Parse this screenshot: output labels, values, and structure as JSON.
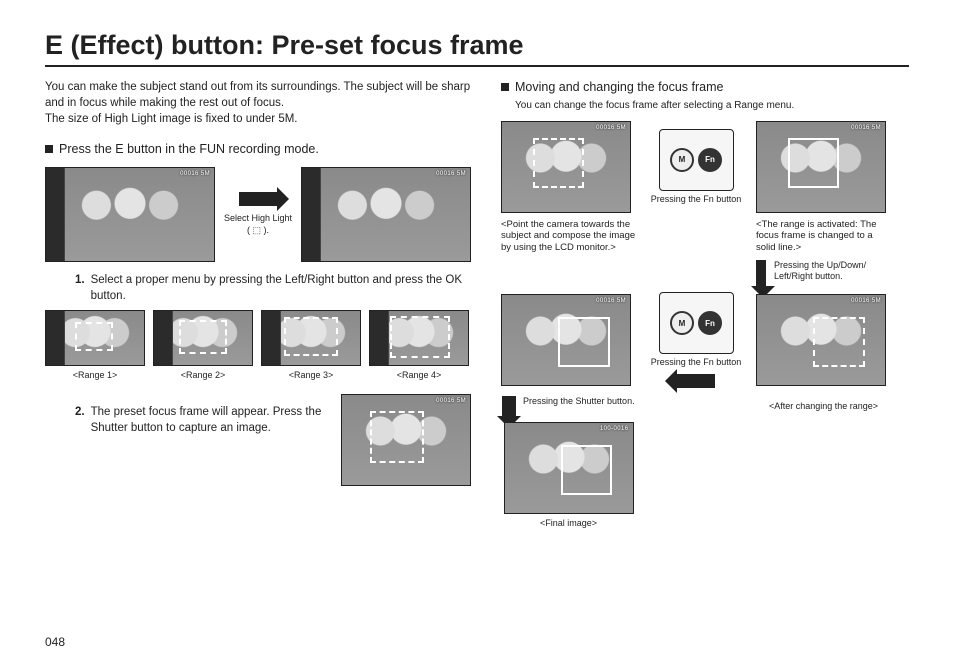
{
  "title": "E (Effect) button: Pre-set focus frame",
  "page_number": "048",
  "left": {
    "intro1": "You can make the subject stand out from its surroundings. The subject will be sharp and in focus while making the rest out of focus.",
    "intro2": "The size of High Light image is fixed to under 5M.",
    "bullet": "Press the E button in the FUN recording mode.",
    "select_highlight": "Select High Light",
    "select_icon_hint": "( ⬚ ).",
    "step1_num": "1.",
    "step1": "Select a proper menu by pressing the Left/Right button and press the OK button.",
    "ranges": [
      "<Range 1>",
      "<Range 2>",
      "<Range 3>",
      "<Range 4>"
    ],
    "step2_num": "2.",
    "step2": "The preset focus frame will appear. Press the Shutter button to capture an image.",
    "status_text": "00016  5M"
  },
  "right": {
    "bullet": "Moving and changing the focus frame",
    "sub": "You can change the focus frame after selecting a Range menu.",
    "dial_m": "M",
    "dial_fn": "Fn",
    "press_fn": "Pressing the Fn button",
    "note_point": "<Point the camera towards the subject and compose the image by using the LCD monitor.>",
    "note_range": "<The range is activated: The focus frame is changed to a solid line.>",
    "press_udlr": "Pressing the Up/Down/ Left/Right button.",
    "after_change": "<After changing the range>",
    "press_shutter": "Pressing the Shutter button.",
    "final_image": "<Final image>",
    "final_status": "100-0016",
    "status_text": "00016  5M"
  }
}
